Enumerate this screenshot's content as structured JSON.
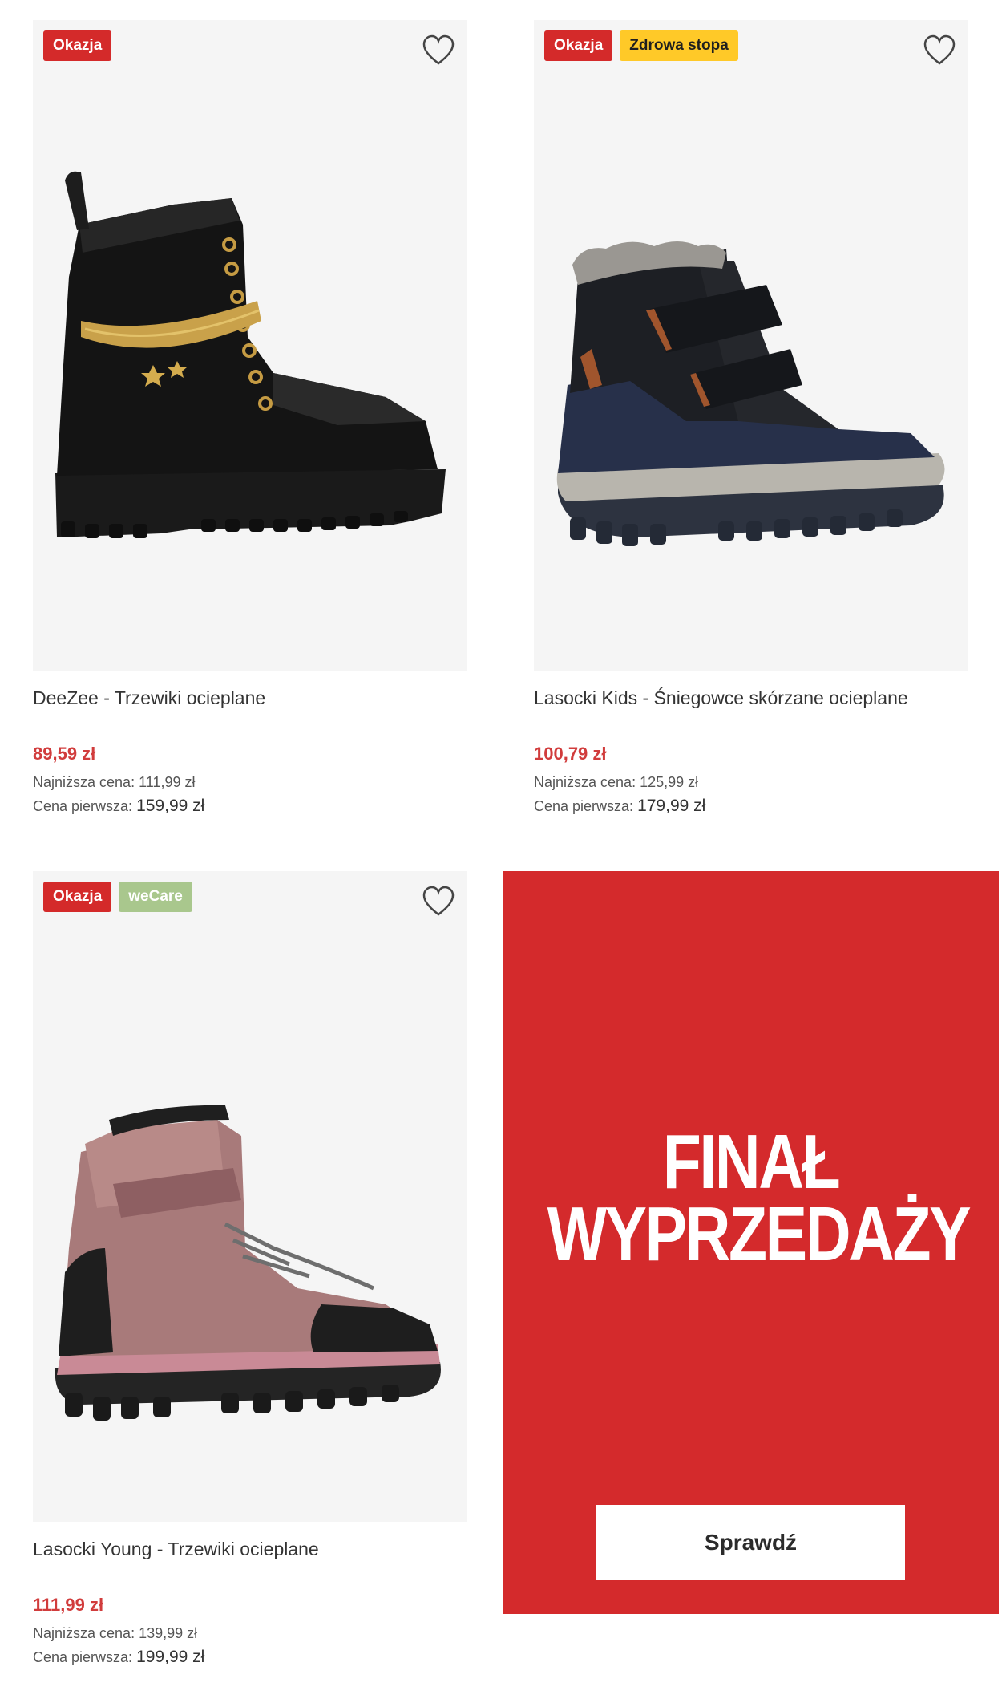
{
  "products": [
    {
      "badges": [
        {
          "label": "Okazja",
          "kind": "okazja"
        }
      ],
      "name": "DeeZee - Trzewiki ocieplane",
      "price": "89,59 zł",
      "lowest_label": "Najniższa cena:",
      "lowest_value": "111,99 zł",
      "first_label": "Cena pierwsza:",
      "first_value": "159,99 zł",
      "image": "black-chain-boot"
    },
    {
      "badges": [
        {
          "label": "Okazja",
          "kind": "okazja"
        },
        {
          "label": "Zdrowa stopa",
          "kind": "zdrowa"
        }
      ],
      "name": "Lasocki Kids - Śniegowce skórzane ocieplane",
      "price": "100,79 zł",
      "lowest_label": "Najniższa cena:",
      "lowest_value": "125,99 zł",
      "first_label": "Cena pierwsza:",
      "first_value": "179,99 zł",
      "image": "kids-snow-boot"
    },
    {
      "badges": [
        {
          "label": "Okazja",
          "kind": "okazja"
        },
        {
          "label": "weCare",
          "kind": "wecare"
        }
      ],
      "name": "Lasocki Young - Trzewiki ocieplane",
      "price": "111,99 zł",
      "lowest_label": "Najniższa cena:",
      "lowest_value": "139,99 zł",
      "first_label": "Cena pierwsza:",
      "first_value": "199,99 zł",
      "image": "pink-hiking-boot"
    }
  ],
  "promo": {
    "title_line1": "FINAŁ",
    "title_line2": "WYPRZEDAŻY",
    "button_label": "Sprawdź"
  },
  "colors": {
    "sale_red": "#d42a2a",
    "price_red": "#d13c3c",
    "badge_yellow": "#ffc928",
    "badge_green": "#a9c78d"
  }
}
